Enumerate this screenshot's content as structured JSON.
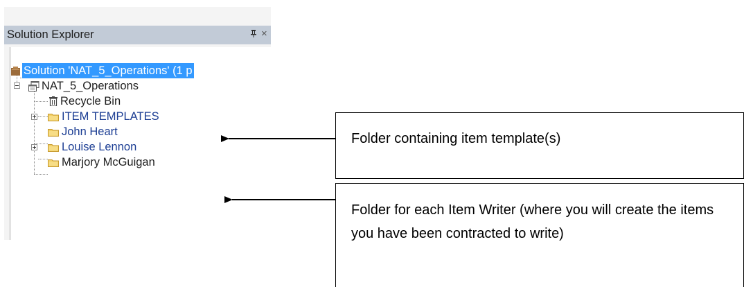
{
  "panel": {
    "title": "Solution Explorer",
    "pin_glyph": "ᴩ",
    "close_glyph": "×"
  },
  "tree": {
    "solution": {
      "label": "Solution 'NAT_5_Operations' (1 p",
      "icon": "solution-icon",
      "selected": true
    },
    "project": {
      "label": "NAT_5_Operations",
      "icon": "project-icon",
      "expanded": true
    },
    "items": [
      {
        "label": "Recycle Bin",
        "icon": "recycle-bin-icon",
        "expander": "none"
      },
      {
        "label": "ITEM TEMPLATES",
        "icon": "folder-icon",
        "expander": "plus"
      },
      {
        "label": "John Heart",
        "icon": "folder-icon",
        "expander": "none"
      },
      {
        "label": "Louise Lennon",
        "icon": "folder-icon",
        "expander": "plus"
      },
      {
        "label": "Marjory McGuigan",
        "icon": "folder-icon",
        "expander": "none"
      }
    ]
  },
  "callouts": [
    {
      "text": "Folder containing item template(s)"
    },
    {
      "text": "Folder for each Item Writer (where you will create the items you have been contracted to write)"
    }
  ],
  "colors": {
    "title_bar": "#c2cbd7",
    "selection": "#3399ff",
    "folder": "#f2cf66",
    "blue_label": "#1b3d93"
  }
}
